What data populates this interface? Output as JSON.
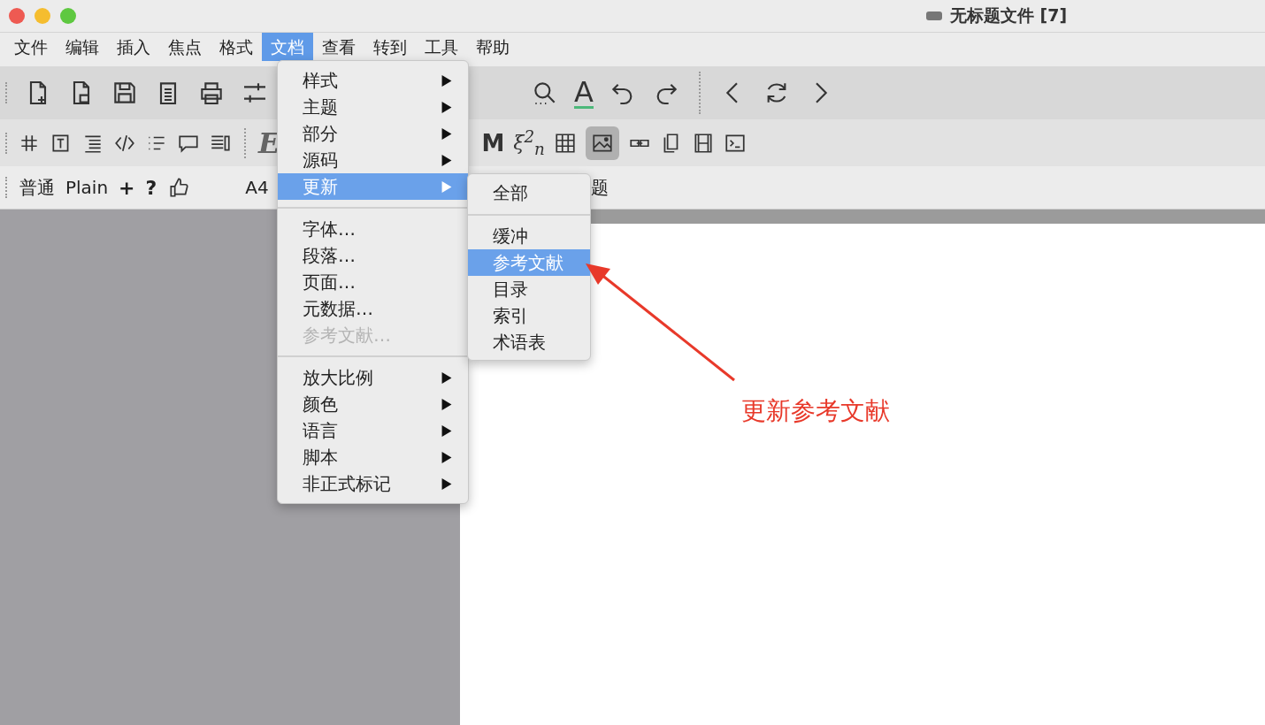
{
  "window": {
    "title": "无标题文件 [7]"
  },
  "menu_bar": [
    {
      "label": "文件",
      "selected": false
    },
    {
      "label": "编辑",
      "selected": false
    },
    {
      "label": "插入",
      "selected": false
    },
    {
      "label": "焦点",
      "selected": false
    },
    {
      "label": "格式",
      "selected": false
    },
    {
      "label": "文档",
      "selected": true
    },
    {
      "label": "查看",
      "selected": false
    },
    {
      "label": "转到",
      "selected": false
    },
    {
      "label": "工具",
      "selected": false
    },
    {
      "label": "帮助",
      "selected": false
    }
  ],
  "toolbar_1": {
    "glyph": "A"
  },
  "toolbar_2": {
    "glyphs": [
      "E",
      "M",
      "ξ$^{2}$$_{n}$"
    ],
    "image_button_pressed": true
  },
  "toolbar_3": {
    "left": [
      "普通",
      "Plain",
      "+",
      "?"
    ],
    "right": [
      "A4",
      "题"
    ]
  },
  "document_menu": {
    "groups": [
      [
        {
          "label": "样式",
          "submenu": true,
          "selected": false,
          "disabled": false
        },
        {
          "label": "主题",
          "submenu": true,
          "selected": false,
          "disabled": false
        },
        {
          "label": "部分",
          "submenu": true,
          "selected": false,
          "disabled": false
        },
        {
          "label": "源码",
          "submenu": true,
          "selected": false,
          "disabled": false
        },
        {
          "label": "更新",
          "submenu": true,
          "selected": true,
          "disabled": false
        }
      ],
      [
        {
          "label": "字体…",
          "submenu": false,
          "selected": false,
          "disabled": false
        },
        {
          "label": "段落…",
          "submenu": false,
          "selected": false,
          "disabled": false
        },
        {
          "label": "页面…",
          "submenu": false,
          "selected": false,
          "disabled": false
        },
        {
          "label": "元数据…",
          "submenu": false,
          "selected": false,
          "disabled": false
        },
        {
          "label": "参考文献…",
          "submenu": false,
          "selected": false,
          "disabled": true
        }
      ],
      [
        {
          "label": "放大比例",
          "submenu": true,
          "selected": false,
          "disabled": false
        },
        {
          "label": "颜色",
          "submenu": true,
          "selected": false,
          "disabled": false
        },
        {
          "label": "语言",
          "submenu": true,
          "selected": false,
          "disabled": false
        },
        {
          "label": "脚本",
          "submenu": true,
          "selected": false,
          "disabled": false
        },
        {
          "label": "非正式标记",
          "submenu": true,
          "selected": false,
          "disabled": false
        }
      ]
    ]
  },
  "update_submenu": {
    "groups": [
      [
        {
          "label": "全部",
          "selected": false
        }
      ],
      [
        {
          "label": "缓冲",
          "selected": false
        },
        {
          "label": "参考文献",
          "selected": true
        },
        {
          "label": "目录",
          "selected": false
        },
        {
          "label": "索引",
          "selected": false
        },
        {
          "label": "术语表",
          "selected": false
        }
      ]
    ]
  },
  "annotation": {
    "label": "更新参考文献"
  }
}
